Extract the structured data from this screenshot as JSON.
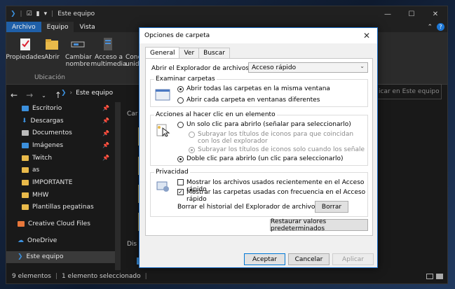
{
  "explorer": {
    "title": "Este equipo",
    "ribbon_tabs": [
      "Archivo",
      "Equipo",
      "Vista"
    ],
    "ribbon_buttons": [
      "Propiedades",
      "Abrir",
      "Cambiar nombre",
      "Acceso a multimedia",
      "Cone unidad"
    ],
    "group_label": "Ubicación",
    "address": "Este equipo",
    "search_placeholder": "icar en Este equipo",
    "nav_items": [
      {
        "label": "Escritorio",
        "pinned": true
      },
      {
        "label": "Descargas",
        "pinned": true
      },
      {
        "label": "Documentos",
        "pinned": true
      },
      {
        "label": "Imágenes",
        "pinned": true
      },
      {
        "label": "Twitch",
        "pinned": true
      },
      {
        "label": "as",
        "pinned": false
      },
      {
        "label": "IMPORTANTE",
        "pinned": false
      },
      {
        "label": "MHW",
        "pinned": false
      },
      {
        "label": "Plantillas pegatinas",
        "pinned": false
      }
    ],
    "nav_top": [
      "Creative Cloud Files",
      "OneDrive",
      "Este equipo"
    ],
    "content_header_1": "Car",
    "content_header_2": "Dis",
    "status": {
      "items": "9 elementos",
      "selected": "1 elemento seleccionado"
    }
  },
  "dialog": {
    "title": "Opciones de carpeta",
    "tabs": [
      "General",
      "Ver",
      "Buscar"
    ],
    "open_label": "Abrir el Explorador de archivos en:",
    "open_value": "Acceso rápido",
    "browse": {
      "legend": "Examinar carpetas",
      "options": [
        "Abrir todas las carpetas en la misma ventana",
        "Abrir cada carpeta en ventanas diferentes"
      ]
    },
    "click": {
      "legend": "Acciones al hacer clic en un elemento",
      "single": "Un solo clic para abrirlo (señalar para seleccionarlo)",
      "sub1": "Subrayar los títulos de iconos para que coincidan con los del explorador",
      "sub2": "Subrayar los títulos de iconos solo cuando los señale",
      "double": "Doble clic para abrirlo (un clic para seleccionarlo)"
    },
    "privacy": {
      "legend": "Privacidad",
      "recent": "Mostrar los archivos usados recientemente en el Acceso rápido",
      "frequent": "Mostrar las carpetas usadas con frecuencia en el Acceso rápido",
      "clear_label": "Borrar el historial del Explorador de archivos",
      "clear_button": "Borrar"
    },
    "restore_button": "Restaurar valores predeterminados",
    "ok": "Aceptar",
    "cancel": "Cancelar",
    "apply": "Aplicar"
  }
}
